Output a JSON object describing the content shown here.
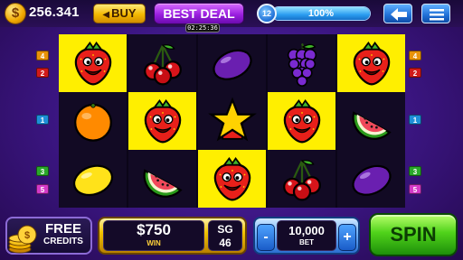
{
  "header": {
    "balance": "256.341",
    "buy_label": "BUY",
    "deal_label": "BEST DEAL",
    "timer": "02:25:36",
    "level": "12",
    "xp_percent": "100%",
    "xp_fraction": 1.0
  },
  "side_markers": {
    "left": [
      "4",
      "2",
      "1",
      "3",
      "5"
    ],
    "right": [
      "4",
      "2",
      "1",
      "3",
      "5"
    ]
  },
  "reels": [
    [
      "strawberry",
      "orange",
      "lemon"
    ],
    [
      "cherry",
      "strawberry",
      "watermelon"
    ],
    [
      "plum",
      "star",
      "strawberry"
    ],
    [
      "grapes",
      "strawberry",
      "cherry"
    ],
    [
      "strawberry",
      "watermelon",
      "plum"
    ]
  ],
  "winning_cells": [
    [
      0,
      0
    ],
    [
      1,
      1
    ],
    [
      2,
      2
    ],
    [
      3,
      1
    ],
    [
      4,
      0
    ]
  ],
  "footer": {
    "free_line1": "FREE",
    "free_line2": "CREDITS",
    "win_amount": "$750",
    "win_label": "WIN",
    "sg_label": "SG",
    "sg_value": "46",
    "bet_minus": "-",
    "bet_value": "10,000",
    "bet_label": "BET",
    "bet_plus": "+",
    "spin_label": "SPIN"
  },
  "colors": {
    "win_highlight": "#ffef00",
    "spin_green": "#4fd21a",
    "deal_purple": "#9b1fe0"
  }
}
